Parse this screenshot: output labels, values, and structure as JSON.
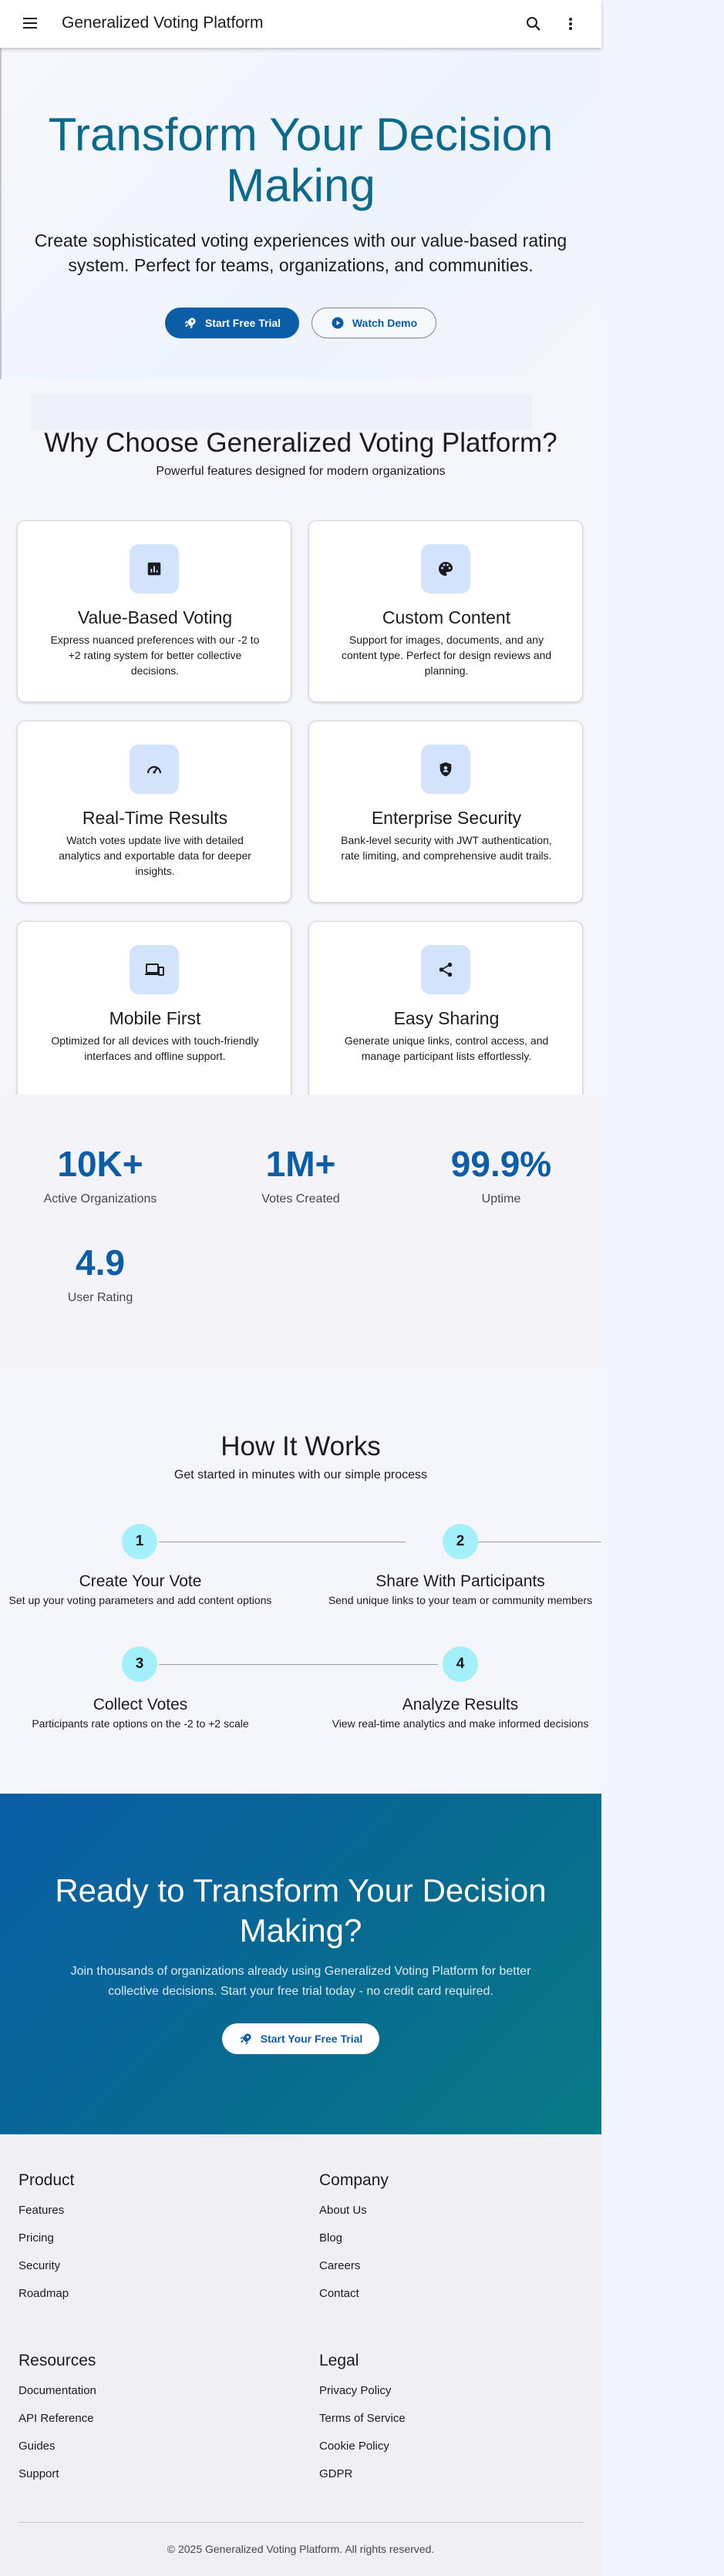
{
  "appbar": {
    "title": "Generalized Voting Platform"
  },
  "hero": {
    "title": "Transform Your Decision Making",
    "subtitle": "Create sophisticated voting experiences with our value-based rating system. Perfect for teams, organizations, and communities.",
    "primary_cta": "Start Free Trial",
    "secondary_cta": "Watch Demo"
  },
  "features": {
    "title": "Why Choose Generalized Voting Platform?",
    "subtitle": "Powerful features designed for modern organizations",
    "items": [
      {
        "icon": "poll-icon",
        "title": "Value-Based Voting",
        "description": "Express nuanced preferences with our -2 to +2 rating system for better collective decisions."
      },
      {
        "icon": "palette-icon",
        "title": "Custom Content",
        "description": "Support for images, documents, and any content type. Perfect for design reviews and planning."
      },
      {
        "icon": "speedometer-icon",
        "title": "Real-Time Results",
        "description": "Watch votes update live with detailed analytics and exportable data for deeper insights."
      },
      {
        "icon": "shield-icon",
        "title": "Enterprise Security",
        "description": "Bank-level security with JWT authentication, rate limiting, and comprehensive audit trails."
      },
      {
        "icon": "devices-icon",
        "title": "Mobile First",
        "description": "Optimized for all devices with touch-friendly interfaces and offline support."
      },
      {
        "icon": "share-icon",
        "title": "Easy Sharing",
        "description": "Generate unique links, control access, and manage participant lists effortlessly."
      }
    ]
  },
  "stats": [
    {
      "value": "10K+",
      "label": "Active Organizations"
    },
    {
      "value": "1M+",
      "label": "Votes Created"
    },
    {
      "value": "99.9%",
      "label": "Uptime"
    },
    {
      "value": "4.9",
      "label": "User Rating"
    }
  ],
  "how": {
    "title": "How It Works",
    "subtitle": "Get started in minutes with our simple process",
    "steps": [
      {
        "number": "1",
        "title": "Create Your Vote",
        "description": "Set up your voting parameters and add content options"
      },
      {
        "number": "2",
        "title": "Share With Participants",
        "description": "Send unique links to your team or community members"
      },
      {
        "number": "3",
        "title": "Collect Votes",
        "description": "Participants rate options on the -2 to +2 scale"
      },
      {
        "number": "4",
        "title": "Analyze Results",
        "description": "View real-time analytics and make informed decisions"
      }
    ]
  },
  "cta": {
    "title": "Ready to Transform Your Decision Making?",
    "text": "Join thousands of organizations already using Generalized Voting Platform for better collective decisions. Start your free trial today - no credit card required.",
    "button": "Start Your Free Trial"
  },
  "footer": {
    "columns": [
      {
        "title": "Product",
        "links": [
          "Features",
          "Pricing",
          "Security",
          "Roadmap"
        ]
      },
      {
        "title": "Company",
        "links": [
          "About Us",
          "Blog",
          "Careers",
          "Contact"
        ]
      },
      {
        "title": "Resources",
        "links": [
          "Documentation",
          "API Reference",
          "Guides",
          "Support"
        ]
      },
      {
        "title": "Legal",
        "links": [
          "Privacy Policy",
          "Terms of Service",
          "Cookie Policy",
          "GDPR"
        ]
      }
    ],
    "copyright": "© 2025 Generalized Voting Platform. All rights reserved."
  }
}
